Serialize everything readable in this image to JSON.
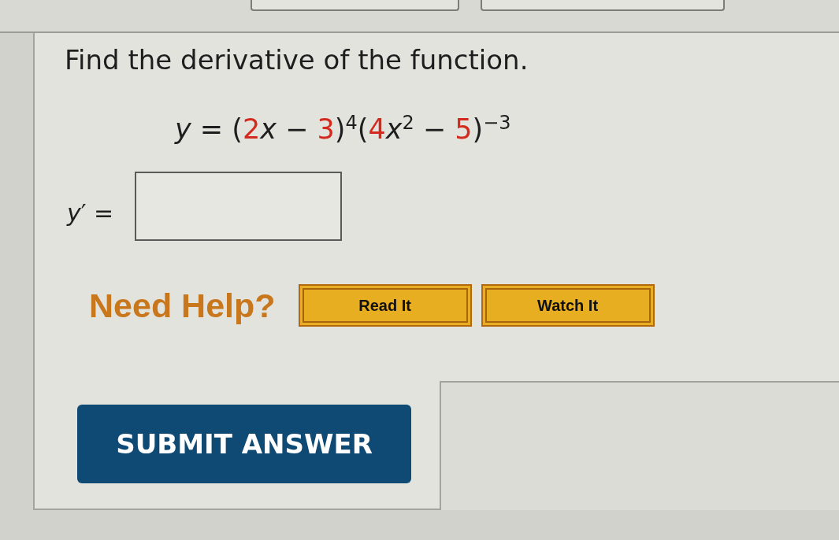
{
  "question": {
    "prompt": "Find the derivative of the function.",
    "equation": [
      {
        "kind": "var",
        "text": "y"
      },
      {
        "kind": "op",
        "text": " = ("
      },
      {
        "kind": "num",
        "text": "2"
      },
      {
        "kind": "var",
        "text": "x"
      },
      {
        "kind": "op",
        "text": " − "
      },
      {
        "kind": "num",
        "text": "3"
      },
      {
        "kind": "op",
        "text": ")"
      },
      {
        "kind": "sup",
        "text": "4"
      },
      {
        "kind": "op",
        "text": "("
      },
      {
        "kind": "num",
        "text": "4"
      },
      {
        "kind": "var",
        "text": "x"
      },
      {
        "kind": "sup",
        "text": "2"
      },
      {
        "kind": "op",
        "text": " − "
      },
      {
        "kind": "num",
        "text": "5"
      },
      {
        "kind": "op",
        "text": ")"
      },
      {
        "kind": "sup",
        "text": "−3"
      }
    ]
  },
  "answer": {
    "label": "*y*′ ="
  },
  "help": {
    "label": "Need Help?",
    "buttons": [
      "Read It",
      "Watch It"
    ]
  },
  "submit": {
    "label": "SUBMIT ANSWER"
  }
}
